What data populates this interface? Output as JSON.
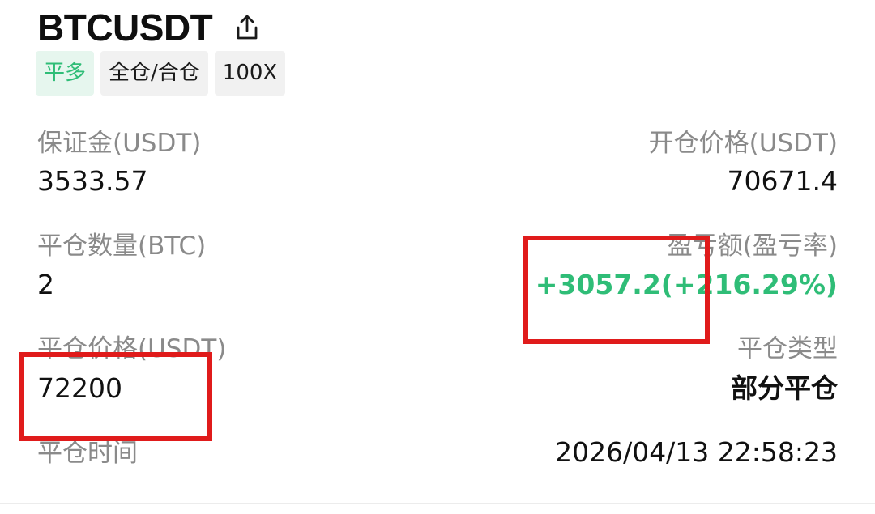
{
  "header": {
    "symbol": "BTCUSDT",
    "share_icon": "share-icon"
  },
  "tags": {
    "side": "平多",
    "margin_mode": "全仓/合仓",
    "leverage": "100X"
  },
  "fields": {
    "margin_label": "保证金(USDT)",
    "margin_value": "3533.57",
    "open_price_label": "开仓价格(USDT)",
    "open_price_value": "70671.4",
    "close_qty_label": "平仓数量(BTC)",
    "close_qty_value": "2",
    "pnl_label": "盈亏额(盈亏率)",
    "pnl_value": "+3057.2(+216.29%)",
    "close_price_label": "平仓价格(USDT)",
    "close_price_value": "72200",
    "close_type_label": "平仓类型",
    "close_type_value": "部分平仓",
    "close_time_label": "平仓时间",
    "close_time_value": "2026/04/13 22:58:23"
  },
  "colors": {
    "profit_green": "#2fbd77",
    "highlight_red": "#e01b1b",
    "label_gray": "#8a8a8a"
  }
}
